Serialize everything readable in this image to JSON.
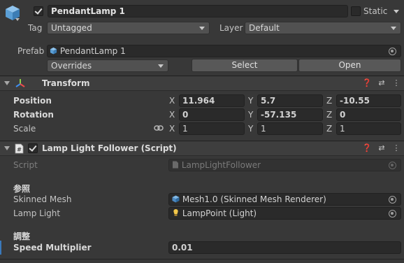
{
  "gameobject": {
    "name": "PendantLamp 1",
    "active": true,
    "static_label": "Static",
    "static": false,
    "tag_label": "Tag",
    "tag_value": "Untagged",
    "layer_label": "Layer",
    "layer_value": "Default",
    "prefab_label": "Prefab",
    "prefab_value": "PendantLamp 1",
    "overrides_label": "Overrides",
    "select_label": "Select",
    "open_label": "Open"
  },
  "transform": {
    "title": "Transform",
    "position_label": "Position",
    "rotation_label": "Rotation",
    "scale_label": "Scale",
    "axis_x": "X",
    "axis_y": "Y",
    "axis_z": "Z",
    "position": {
      "x": "11.964",
      "y": "5.7",
      "z": "-10.55"
    },
    "rotation": {
      "x": "0",
      "y": "-57.135",
      "z": "0"
    },
    "scale": {
      "x": "1",
      "y": "1",
      "z": "1"
    }
  },
  "script_component": {
    "title": "Lamp Light Follower (Script)",
    "enabled": true,
    "script_label": "Script",
    "script_value": "LampLightFollower",
    "section_reference": "参照",
    "skinned_mesh_label": "Skinned Mesh",
    "skinned_mesh_value": "Mesh1.0 (Skinned Mesh Renderer)",
    "lamp_light_label": "Lamp Light",
    "lamp_light_value": "LampPoint (Light)",
    "section_adjust": "調整",
    "speed_label": "Speed Multiplier",
    "speed_value": "0.01"
  },
  "colors": {
    "background": "#383838",
    "field": "#2a2a2a",
    "highlight_bar": "#3a79bb"
  }
}
